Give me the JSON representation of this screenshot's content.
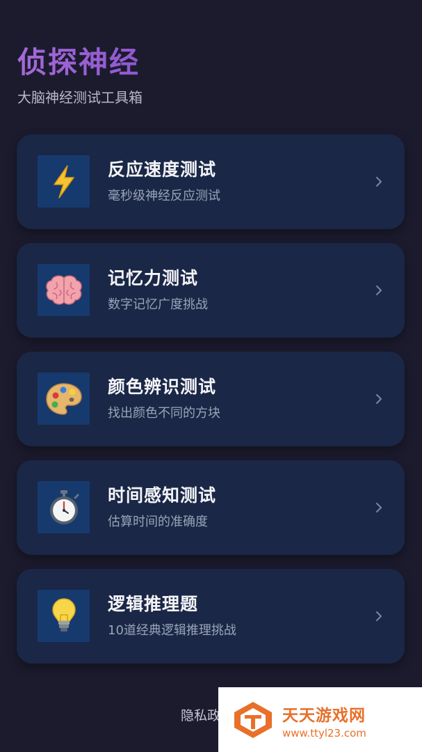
{
  "header": {
    "title": "侦探神经",
    "subtitle": "大脑神经测试工具箱"
  },
  "tests": [
    {
      "title": "反应速度测试",
      "description": "毫秒级神经反应测试",
      "icon": "lightning-icon"
    },
    {
      "title": "记忆力测试",
      "description": "数字记忆广度挑战",
      "icon": "brain-icon"
    },
    {
      "title": "颜色辨识测试",
      "description": "找出颜色不同的方块",
      "icon": "palette-icon"
    },
    {
      "title": "时间感知测试",
      "description": "估算时间的准确度",
      "icon": "stopwatch-icon"
    },
    {
      "title": "逻辑推理题",
      "description": "10道经典逻辑推理挑战",
      "icon": "lightbulb-icon"
    }
  ],
  "footer": {
    "privacy_label": "隐私政策"
  },
  "watermark": {
    "name": "天天游戏网",
    "url": "www.ttyl23.com"
  },
  "colors": {
    "background": "#1c1b2e",
    "card": "#1a2746",
    "icon_tile": "#173a6e",
    "title_accent": "#9b5fd6",
    "watermark_accent": "#e8702a"
  }
}
